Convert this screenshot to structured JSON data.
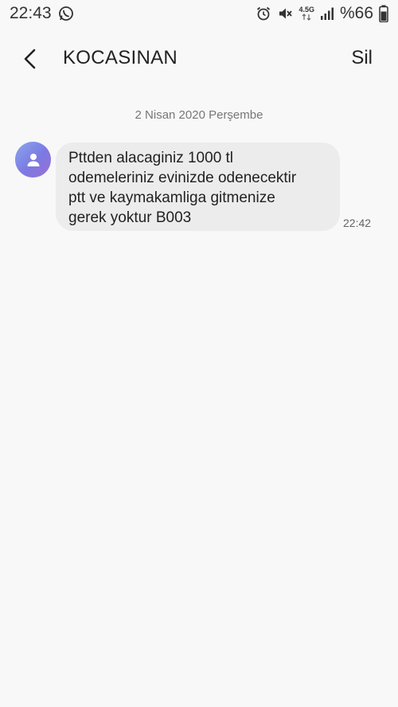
{
  "status_bar": {
    "time": "22:43",
    "network_label_top": "4.5G",
    "battery_text": "%66",
    "icons": [
      "whatsapp-icon",
      "alarm-icon",
      "mute-icon",
      "network-icon",
      "signal-icon",
      "battery-icon"
    ]
  },
  "header": {
    "title": "KOCASINAN",
    "delete_label": "Sil"
  },
  "conversation": {
    "date_separator": "2 Nisan 2020 Perşembe",
    "messages": [
      {
        "lines": [
          "Pttden alacaginiz 1000 tl",
          "odemeleriniz evinizde odenecektir",
          "ptt ve kaymakamliga gitmenize",
          "gerek yoktur B003"
        ],
        "time": "22:42"
      }
    ]
  },
  "colors": {
    "background": "#f8f8f8",
    "bubble": "#ececec",
    "avatar_gradient_start": "#8aa7ee",
    "avatar_gradient_end": "#9a6fd6"
  }
}
